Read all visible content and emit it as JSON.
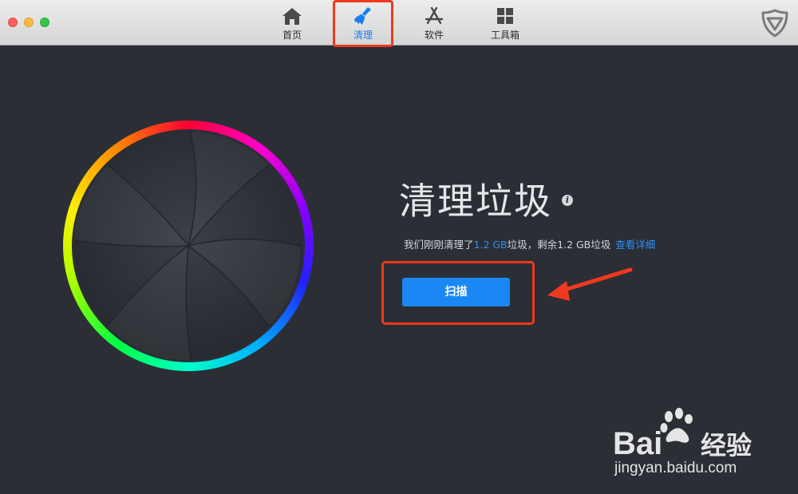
{
  "window": {
    "controls": [
      "close",
      "minimize",
      "maximize"
    ]
  },
  "tabs": [
    {
      "label": "首页",
      "icon": "home-icon",
      "active": false
    },
    {
      "label": "清理",
      "icon": "broom-icon",
      "active": true
    },
    {
      "label": "软件",
      "icon": "app-store-icon",
      "active": false
    },
    {
      "label": "工具箱",
      "icon": "toolbox-grid-icon",
      "active": false
    }
  ],
  "header": {
    "logo_icon": "shield-logo-icon"
  },
  "main": {
    "title": "清理垃圾",
    "info_icon": "info-icon",
    "status": {
      "prefix": "我们刚刚清理了",
      "cleaned": "1.2 GB",
      "middle": "垃圾，剩余1.2 GB垃圾",
      "link": "查看详细"
    },
    "scan_button": "扫描"
  },
  "watermark": {
    "brand_left": "Bai",
    "brand_right": "经验",
    "url": "jingyan.baidu.com"
  },
  "colors": {
    "accent": "#1a87f5",
    "background": "#2b2e35",
    "annotation": "#f0391f"
  }
}
